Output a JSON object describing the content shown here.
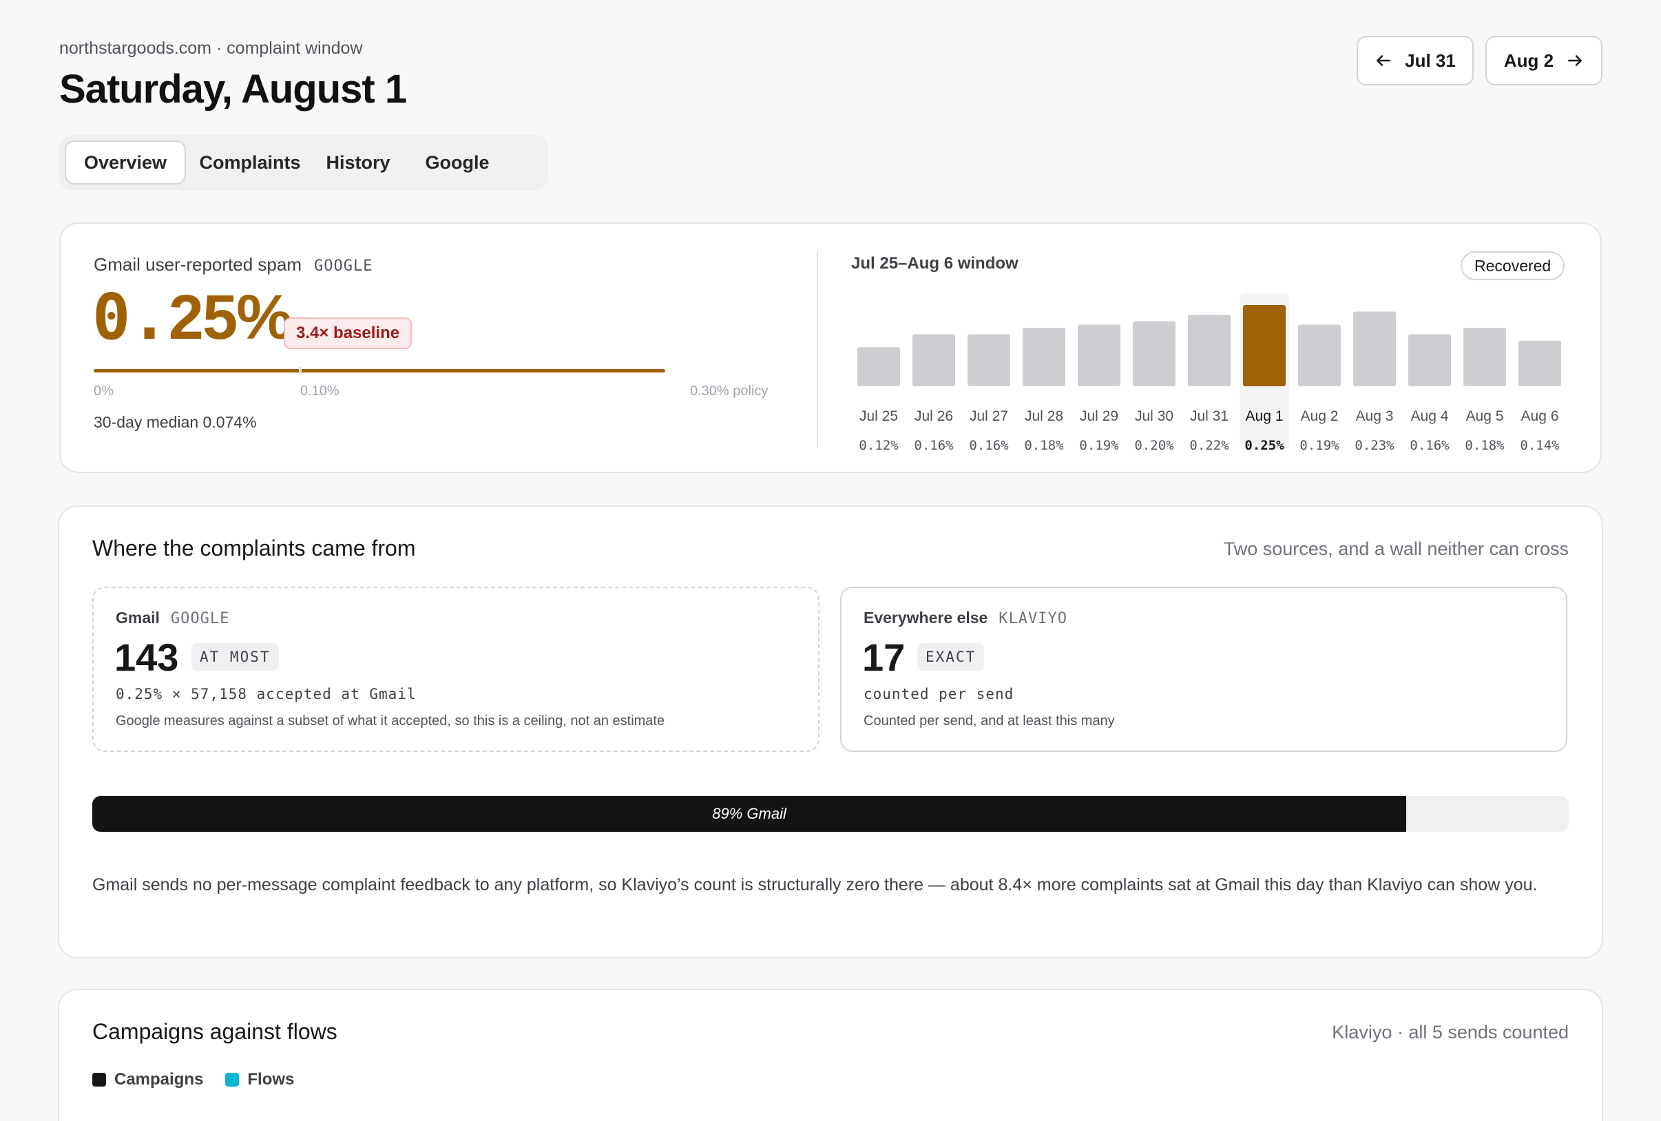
{
  "header": {
    "crumb": "northstargoods.com · complaint window",
    "title": "Saturday, August 1",
    "prev_label": "Jul 31",
    "next_label": "Aug 2"
  },
  "tabs": [
    {
      "label": "Overview",
      "active": true
    },
    {
      "label": "Complaints",
      "active": false
    },
    {
      "label": "History",
      "active": false
    },
    {
      "label": "Google",
      "active": false
    }
  ],
  "spam": {
    "label": "Gmail user-reported spam",
    "source": "GOOGLE",
    "rate_num": "0.",
    "rate_rest": "25%",
    "baseline": "3.4× baseline",
    "scale_min": "0%",
    "scale_mid": "0.10%",
    "scale_max": "0.30% policy",
    "median": "30-day median 0.074%"
  },
  "window": {
    "title": "Jul 25–Aug 6 window",
    "status": "Recovered"
  },
  "chart_data": {
    "type": "bar",
    "categories": [
      "Jul 25",
      "Jul 26",
      "Jul 27",
      "Jul 28",
      "Jul 29",
      "Jul 30",
      "Jul 31",
      "Aug 1",
      "Aug 2",
      "Aug 3",
      "Aug 4",
      "Aug 5",
      "Aug 6"
    ],
    "values": [
      0.12,
      0.16,
      0.16,
      0.18,
      0.19,
      0.2,
      0.22,
      0.25,
      0.19,
      0.23,
      0.16,
      0.18,
      0.14
    ],
    "value_labels": [
      "0.12%",
      "0.16%",
      "0.16%",
      "0.18%",
      "0.19%",
      "0.20%",
      "0.22%",
      "0.25%",
      "0.19%",
      "0.23%",
      "0.16%",
      "0.18%",
      "0.14%"
    ],
    "highlight": "Aug 1",
    "ylim": [
      0,
      0.25
    ],
    "colors": {
      "bar": "#cdcdd2",
      "highlight": "#a16207"
    },
    "grid": false
  },
  "sources": {
    "title": "Where the complaints came from",
    "note": "Two sources, and a wall neither can cross",
    "gmail": {
      "name": "Gmail",
      "tag": "GOOGLE",
      "count": "143",
      "qualifier": "AT MOST",
      "formula": "0.25% × 57,158 accepted at Gmail",
      "foot": "Google measures against a subset of what it accepted, so this is a ceiling, not an estimate"
    },
    "other": {
      "name": "Everywhere else",
      "tag": "KLAVIYO",
      "count": "17",
      "qualifier": "EXACT",
      "formula": "counted per send",
      "foot": "Counted per send, and at least this many"
    },
    "share_fraction": 0.89,
    "share_label": "89% Gmail",
    "explain": "Gmail sends no per-message complaint feedback to any platform, so Klaviyo’s count is structurally zero there — about 8.4× more complaints sat at Gmail this day than Klaviyo can show you."
  },
  "campaigns": {
    "title": "Campaigns against flows",
    "note": "Klaviyo · all 5 sends counted",
    "legend": [
      {
        "label": "Campaigns",
        "color": "#18181b"
      },
      {
        "label": "Flows",
        "color": "#06b6d4"
      }
    ]
  }
}
